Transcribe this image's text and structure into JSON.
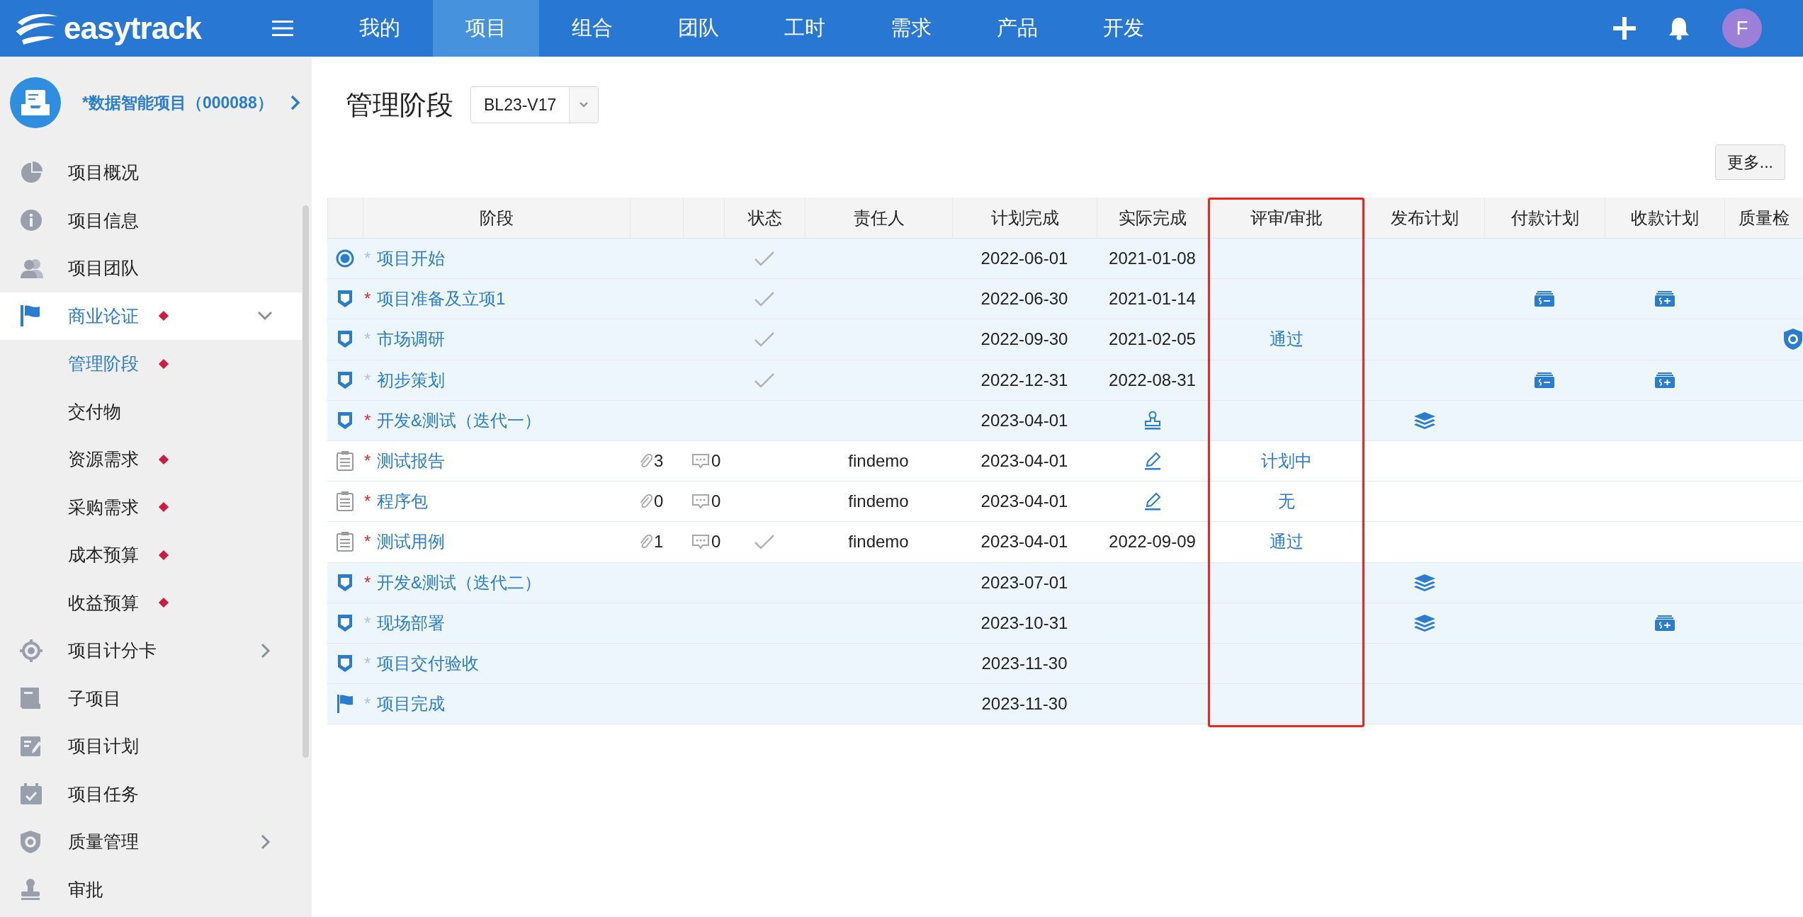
{
  "topbar": {
    "logo": "easytrack",
    "tabs": [
      {
        "label": "我的",
        "selected": false
      },
      {
        "label": "项目",
        "selected": true
      },
      {
        "label": "组合",
        "selected": false
      },
      {
        "label": "团队",
        "selected": false
      },
      {
        "label": "工时",
        "selected": false
      },
      {
        "label": "需求",
        "selected": false
      },
      {
        "label": "产品",
        "selected": false
      },
      {
        "label": "开发",
        "selected": false
      }
    ],
    "avatar": "F"
  },
  "sidebar": {
    "project": "*数据智能项目（000088）",
    "items": [
      {
        "label": "项目概况",
        "selected": false,
        "flagged": false,
        "expandable": false
      },
      {
        "label": "项目信息",
        "selected": false,
        "flagged": false,
        "expandable": false
      },
      {
        "label": "项目团队",
        "selected": false,
        "flagged": false,
        "expandable": false
      },
      {
        "label": "商业论证",
        "selected": true,
        "flagged": true,
        "expandable": true,
        "expanded": true,
        "children": [
          {
            "label": "管理阶段",
            "selected": true,
            "flagged": true
          },
          {
            "label": "交付物",
            "selected": false,
            "flagged": false
          },
          {
            "label": "资源需求",
            "selected": false,
            "flagged": true
          },
          {
            "label": "采购需求",
            "selected": false,
            "flagged": true
          },
          {
            "label": "成本预算",
            "selected": false,
            "flagged": true
          },
          {
            "label": "收益预算",
            "selected": false,
            "flagged": true
          }
        ]
      },
      {
        "label": "项目计分卡",
        "selected": false,
        "flagged": false,
        "expandable": true,
        "expanded": false
      },
      {
        "label": "子项目",
        "selected": false,
        "flagged": false,
        "expandable": false
      },
      {
        "label": "项目计划",
        "selected": false,
        "flagged": false,
        "expandable": false
      },
      {
        "label": "项目任务",
        "selected": false,
        "flagged": false,
        "expandable": false
      },
      {
        "label": "质量管理",
        "selected": false,
        "flagged": false,
        "expandable": true,
        "expanded": false
      },
      {
        "label": "审批",
        "selected": false,
        "flagged": false,
        "expandable": false
      }
    ]
  },
  "page": {
    "title": "管理阶段",
    "baseline": "BL23-V17",
    "more_button": "更多..."
  },
  "table": {
    "columns": [
      {
        "label": "阶段",
        "highlight": false
      },
      {
        "label": "状态",
        "highlight": false
      },
      {
        "label": "责任人",
        "highlight": false
      },
      {
        "label": "计划完成",
        "highlight": false
      },
      {
        "label": "实际完成",
        "highlight": false
      },
      {
        "label": "评审/审批",
        "highlight": true
      },
      {
        "label": "发布计划",
        "highlight": false
      },
      {
        "label": "付款计划",
        "highlight": false
      },
      {
        "label": "收款计划",
        "highlight": false
      },
      {
        "label": "质量检",
        "highlight": false
      }
    ],
    "rows": [
      {
        "kind": "milestone",
        "mark": "*",
        "required": false,
        "name": "项目开始",
        "done": true,
        "planned": "2022-06-01",
        "actual": "2021-01-08",
        "release": false,
        "payment": false,
        "receipt": false,
        "quality": false
      },
      {
        "kind": "phase",
        "mark": "*",
        "required": true,
        "name": "项目准备及立项1",
        "done": true,
        "planned": "2022-06-30",
        "actual": "2021-01-14",
        "release": false,
        "payment": true,
        "receipt": true,
        "quality": false
      },
      {
        "kind": "phase",
        "mark": "*",
        "required": false,
        "name": "市场调研",
        "done": true,
        "planned": "2022-09-30",
        "actual": "2021-02-05",
        "review": "通过",
        "release": false,
        "payment": false,
        "receipt": false,
        "quality": true
      },
      {
        "kind": "phase",
        "mark": "*",
        "required": false,
        "name": "初步策划",
        "done": true,
        "planned": "2022-12-31",
        "actual": "2022-08-31",
        "release": false,
        "payment": true,
        "receipt": true,
        "quality": false
      },
      {
        "kind": "phase",
        "mark": "*",
        "required": true,
        "name": "开发&测试（迭代一）",
        "done": false,
        "planned": "2023-04-01",
        "action": {
          "kind": "stamp"
        },
        "release": true,
        "payment": false,
        "receipt": false,
        "quality": false
      },
      {
        "kind": "deliverable",
        "mark": "*",
        "required": true,
        "name": "测试报告",
        "attachments": "3",
        "comments": "0",
        "done": false,
        "owner": "findemo",
        "planned": "2023-04-01",
        "action": {
          "kind": "edit"
        },
        "review": "计划中",
        "release": false,
        "payment": false,
        "receipt": false,
        "quality": false
      },
      {
        "kind": "deliverable",
        "mark": "*",
        "required": true,
        "name": "程序包",
        "attachments": "0",
        "comments": "0",
        "done": false,
        "owner": "findemo",
        "planned": "2023-04-01",
        "action": {
          "kind": "edit"
        },
        "review": "无",
        "release": false,
        "payment": false,
        "receipt": false,
        "quality": false
      },
      {
        "kind": "deliverable",
        "mark": "*",
        "required": true,
        "name": "测试用例",
        "attachments": "1",
        "comments": "0",
        "done": true,
        "owner": "findemo",
        "planned": "2023-04-01",
        "actual": "2022-09-09",
        "review": "通过",
        "release": false,
        "payment": false,
        "receipt": false,
        "quality": false
      },
      {
        "kind": "phase",
        "mark": "*",
        "required": true,
        "name": "开发&测试（迭代二）",
        "done": false,
        "planned": "2023-07-01",
        "release": true,
        "payment": false,
        "receipt": false,
        "quality": false
      },
      {
        "kind": "phase",
        "mark": "*",
        "required": false,
        "name": "现场部署",
        "done": false,
        "planned": "2023-10-31",
        "release": true,
        "payment": false,
        "receipt": true,
        "quality": false
      },
      {
        "kind": "phase",
        "mark": "*",
        "required": false,
        "name": "项目交付验收",
        "done": false,
        "planned": "2023-11-30",
        "release": false,
        "payment": false,
        "receipt": false,
        "quality": false
      },
      {
        "kind": "end",
        "mark": "*",
        "required": false,
        "name": "项目完成",
        "done": false,
        "planned": "2023-11-30",
        "release": false,
        "payment": false,
        "receipt": false,
        "quality": false
      }
    ]
  }
}
